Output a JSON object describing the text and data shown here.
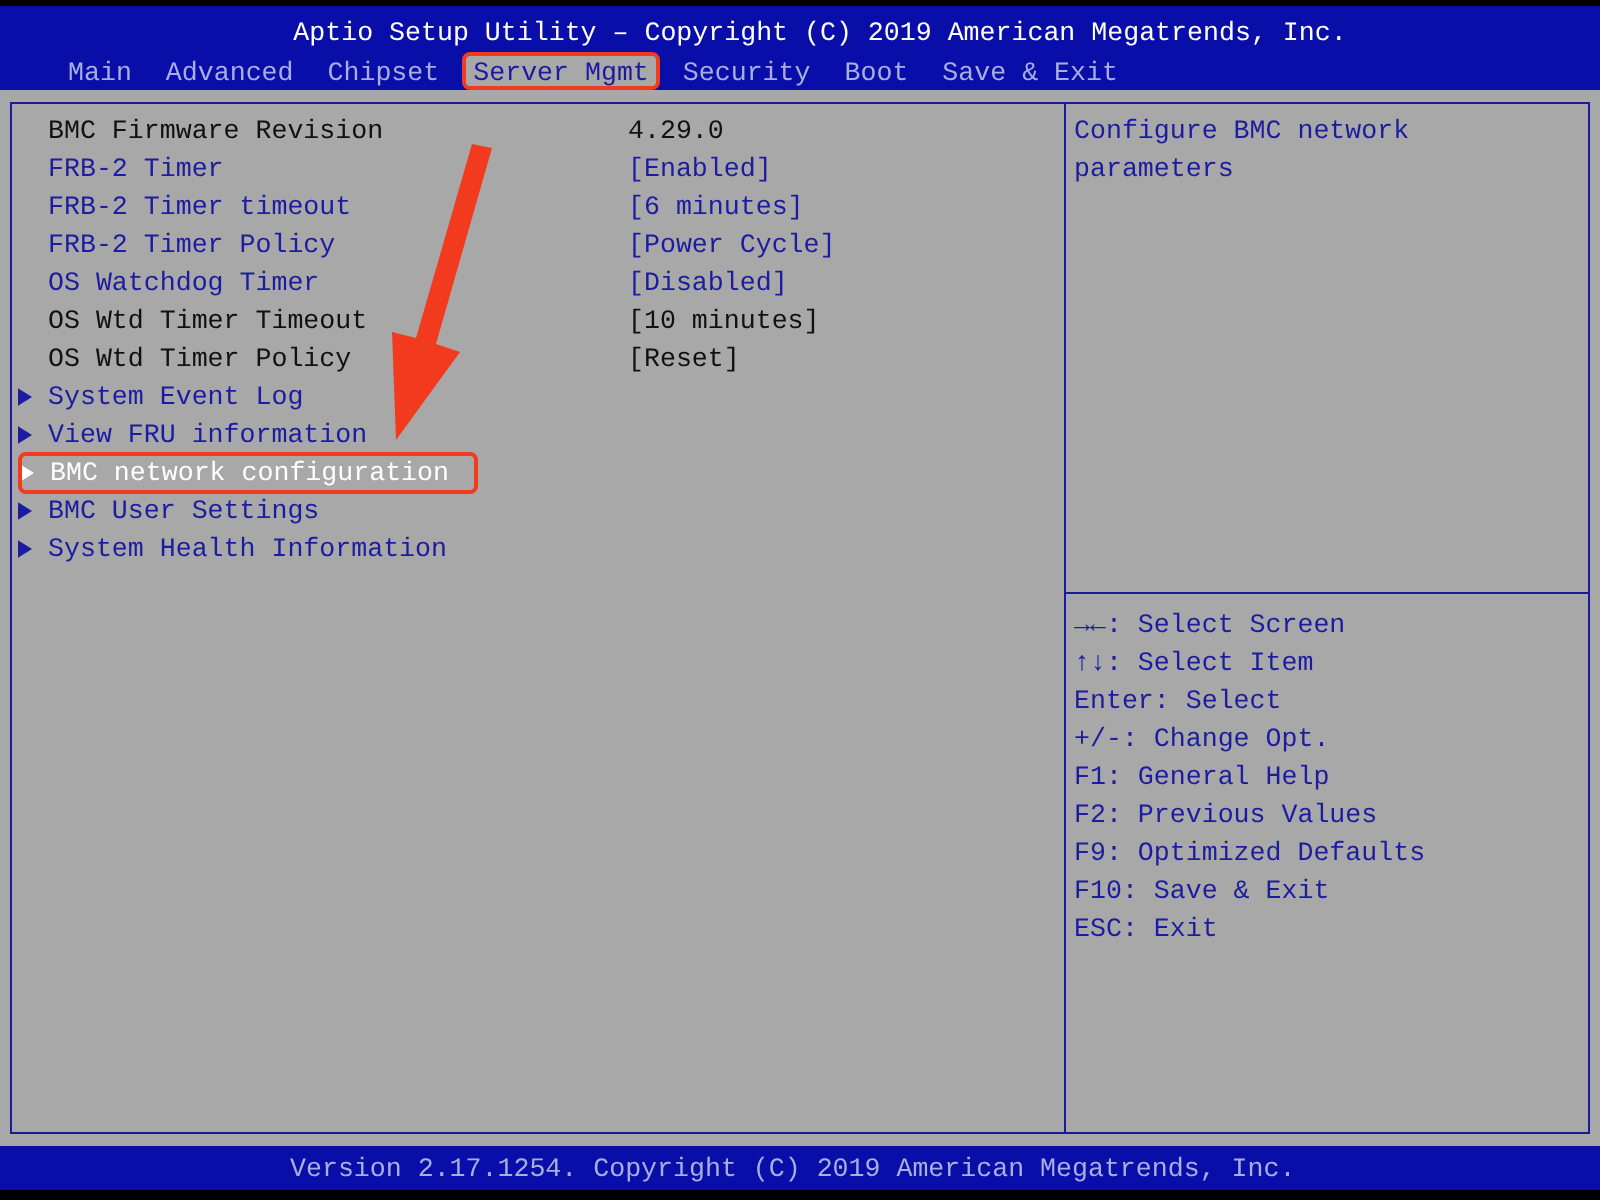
{
  "header": {
    "title": "Aptio Setup Utility – Copyright (C) 2019 American Megatrends, Inc."
  },
  "tabs": [
    {
      "label": "Main",
      "selected": false,
      "annotated": false
    },
    {
      "label": "Advanced",
      "selected": false,
      "annotated": false
    },
    {
      "label": "Chipset",
      "selected": false,
      "annotated": false
    },
    {
      "label": "Server Mgmt",
      "selected": true,
      "annotated": true
    },
    {
      "label": "Security",
      "selected": false,
      "annotated": false
    },
    {
      "label": "Boot",
      "selected": false,
      "annotated": false
    },
    {
      "label": "Save & Exit",
      "selected": false,
      "annotated": false
    }
  ],
  "settings": [
    {
      "kind": "info",
      "label": "BMC Firmware Revision",
      "value": "4.29.0",
      "selected": false,
      "annotated": false
    },
    {
      "kind": "option",
      "label": "FRB-2 Timer",
      "value": "[Enabled]",
      "selected": false,
      "annotated": false
    },
    {
      "kind": "option",
      "label": "FRB-2 Timer timeout",
      "value": "[6 minutes]",
      "selected": false,
      "annotated": false
    },
    {
      "kind": "option",
      "label": "FRB-2 Timer Policy",
      "value": "[Power Cycle]",
      "selected": false,
      "annotated": false
    },
    {
      "kind": "option",
      "label": "OS Watchdog Timer",
      "value": "[Disabled]",
      "selected": false,
      "annotated": false
    },
    {
      "kind": "info",
      "label": "OS Wtd Timer Timeout",
      "value": "[10 minutes]",
      "selected": false,
      "annotated": false
    },
    {
      "kind": "info",
      "label": "OS Wtd Timer Policy",
      "value": "[Reset]",
      "selected": false,
      "annotated": false
    },
    {
      "kind": "submenu",
      "label": "System Event Log",
      "selected": false,
      "annotated": false
    },
    {
      "kind": "submenu",
      "label": "View FRU information",
      "selected": false,
      "annotated": false
    },
    {
      "kind": "submenu",
      "label": "BMC network configuration",
      "selected": true,
      "annotated": true
    },
    {
      "kind": "submenu",
      "label": "BMC User Settings",
      "selected": false,
      "annotated": false
    },
    {
      "kind": "submenu",
      "label": "System Health Information",
      "selected": false,
      "annotated": false
    }
  ],
  "help": {
    "text": "Configure BMC network parameters"
  },
  "keys": [
    "→←: Select Screen",
    "↑↓: Select Item",
    "Enter: Select",
    "+/-: Change Opt.",
    "F1: General Help",
    "F2: Previous Values",
    "F9: Optimized Defaults",
    "F10: Save & Exit",
    "ESC: Exit"
  ],
  "footer": {
    "text": "Version 2.17.1254. Copyright (C) 2019 American Megatrends, Inc."
  }
}
